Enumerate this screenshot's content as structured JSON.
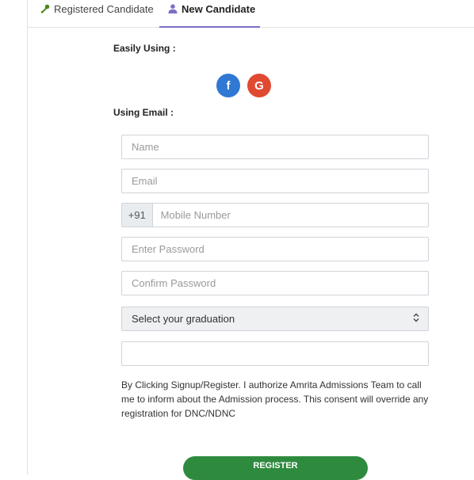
{
  "tabs": {
    "registered": {
      "label": "Registered Candidate",
      "icon": "key-icon"
    },
    "new": {
      "label": "New Candidate",
      "icon": "user-icon"
    }
  },
  "social": {
    "label": "Easily Using :",
    "facebook_letter": "f",
    "google_letter": "G"
  },
  "email_section": {
    "label": "Using Email :"
  },
  "form": {
    "name_placeholder": "Name",
    "email_placeholder": "Email",
    "mobile_prefix": "+91",
    "mobile_placeholder": "Mobile Number",
    "password_placeholder": "Enter Password",
    "confirm_placeholder": "Confirm Password",
    "graduation_selected": "Select your graduation",
    "extra_value": ""
  },
  "consent": "By Clicking Signup/Register. I authorize Amrita Admissions Team to call me to inform about the Admission process. This consent will override any registration for DNC/NDNC",
  "register_label": "REGISTER",
  "colors": {
    "active_tab_underline": "#7b6fc7",
    "facebook": "#2f78d4",
    "google": "#e04a31",
    "register": "#2e8b3e"
  }
}
